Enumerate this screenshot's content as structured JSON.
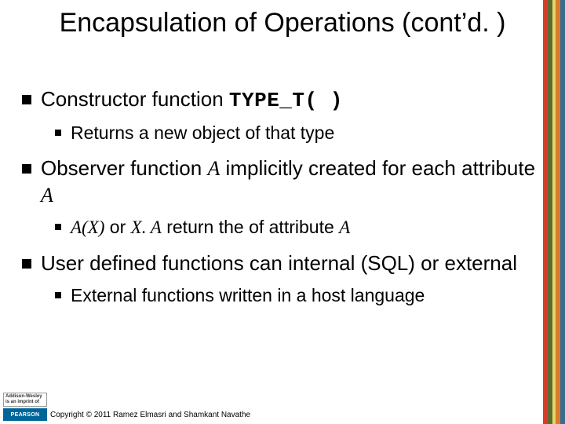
{
  "title": "Encapsulation of Operations (cont’d. )",
  "bullets": {
    "b1_prefix": "Constructor function ",
    "b1_code": "TYPE_T( )",
    "b1_sub": "Returns a new object of that type",
    "b2_prefix": "Observer function ",
    "b2_em1": "A",
    "b2_mid": " implicitly created for each attribute ",
    "b2_em2": "A",
    "b2_sub_em1": "A(X)",
    "b2_sub_mid1": " or ",
    "b2_sub_em2": "X. A",
    "b2_sub_mid2": " return the of attribute ",
    "b2_sub_em3": "A",
    "b3": "User defined functions can internal (SQL) or external",
    "b3_sub": "External functions written in a host language"
  },
  "footer": {
    "copyright": "Copyright © 2011 Ramez Elmasri and Shamkant Navathe",
    "logo_aw_line1": "Addison-Wesley",
    "logo_aw_line2": "is an imprint of",
    "logo_pearson": "PEARSON"
  }
}
